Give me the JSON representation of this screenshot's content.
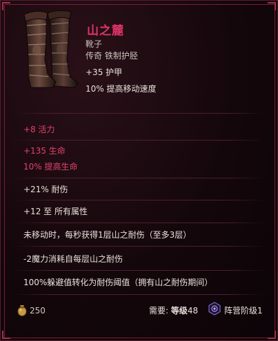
{
  "item": {
    "name": "山之麓",
    "slot_type": "靴子",
    "base": "传奇 铁制护胫",
    "implicits": [
      "+35 护甲",
      "10% 提高移动速度"
    ]
  },
  "affixes": {
    "vitality": "+8 活力",
    "health": "+135 生命",
    "health_pct": "10% 提高生命",
    "endurance": "+21% 耐伤",
    "all_attributes": "+12 至 所有属性",
    "unique_1": "未移动时，每秒获得1层山之耐伤（至多3层）",
    "unique_2": "-2魔力消耗自每层山之耐伤",
    "unique_3": "100%躲避值转化为耐伤阈值（拥有山之耐伤期间）"
  },
  "footer": {
    "gold_icon": "gold-pouch-icon",
    "gold": "250",
    "requirement_prefix": "需要:",
    "requirement_word": "等级",
    "requirement_level": "48",
    "faction_icon": "faction-emblem-icon",
    "faction_rank": "阵营阶级1"
  },
  "colors": {
    "title": "#e0356a",
    "sealed_affix": "#e2426e",
    "text": "#e8e2dc",
    "border": "#7a1e38"
  }
}
